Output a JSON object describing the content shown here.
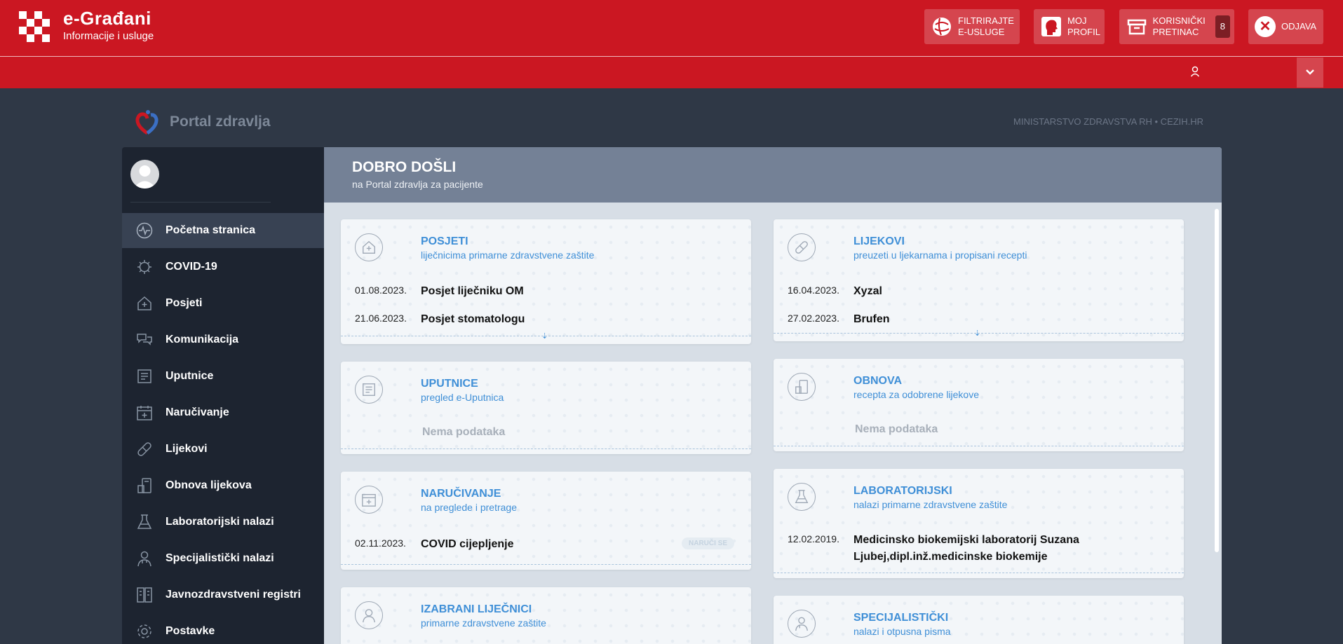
{
  "header": {
    "title": "e-Građani",
    "subtitle": "Informacije i usluge",
    "buttons": {
      "filter": "FILTRIRAJTE E-USLUGE",
      "profile": "MOJ PROFIL",
      "inbox": "KORISNIČKI PRETINAC",
      "inbox_count": "8",
      "logout": "ODJAVA"
    },
    "colors": {
      "brand": "#cb1722"
    }
  },
  "portal": {
    "title": "Portal zdravlja",
    "ministry": "MINISTARSTVO ZDRAVSTVA RH • CEZIH.HR"
  },
  "sidebar": {
    "items": [
      {
        "label": "Početna stranica",
        "icon": "pulse-icon"
      },
      {
        "label": "COVID-19",
        "icon": "virus-icon"
      },
      {
        "label": "Posjeti",
        "icon": "clinic-icon"
      },
      {
        "label": "Komunikacija",
        "icon": "chat-icon"
      },
      {
        "label": "Uputnice",
        "icon": "document-icon"
      },
      {
        "label": "Naručivanje",
        "icon": "calendar-icon"
      },
      {
        "label": "Lijekovi",
        "icon": "pill-icon"
      },
      {
        "label": "Obnova lijekova",
        "icon": "renew-icon"
      },
      {
        "label": "Laboratorijski nalazi",
        "icon": "flask-icon"
      },
      {
        "label": "Specijalistički nalazi",
        "icon": "doctor-icon"
      },
      {
        "label": "Javnozdravstveni registri",
        "icon": "registry-icon"
      },
      {
        "label": "Postavke",
        "icon": "gear-icon"
      }
    ]
  },
  "main": {
    "welcome": "DOBRO DOŠLI",
    "welcome_sub": "na Portal zdravlja za pacijente",
    "cards": {
      "posjeti": {
        "title": "POSJETI",
        "subtitle": "liječnicima primarne zdravstvene zaštite",
        "rows": [
          {
            "date": "01.08.2023.",
            "value": "Posjet liječniku OM"
          },
          {
            "date": "21.06.2023.",
            "value": "Posjet stomatologu"
          }
        ]
      },
      "lijekovi": {
        "title": "LIJEKOVI",
        "subtitle": "preuzeti u ljekarnama i propisani recepti",
        "rows": [
          {
            "date": "16.04.2023.",
            "value": "Xyzal"
          },
          {
            "date": "27.02.2023.",
            "value": "Brufen"
          }
        ]
      },
      "uputnice": {
        "title": "UPUTNICE",
        "subtitle": "pregled e-Uputnica",
        "empty": "Nema podataka"
      },
      "obnova": {
        "title": "OBNOVA",
        "subtitle": "recepta za odobrene lijekove",
        "empty": "Nema podataka"
      },
      "narucivanje": {
        "title": "NARUČIVANJE",
        "subtitle": "na preglede i pretrage",
        "rows": [
          {
            "date": "02.11.2023.",
            "value": "COVID cijepljenje"
          }
        ],
        "action": "NARUČI SE"
      },
      "laboratorijski": {
        "title": "LABORATORIJSKI",
        "subtitle": "nalazi primarne zdravstvene zaštite",
        "rows": [
          {
            "date": "12.02.2019.",
            "value": "Medicinsko biokemijski laboratorij Suzana Ljubej,dipl.inž.medicinske biokemije"
          }
        ]
      },
      "izabrani": {
        "title": "IZABRANI LIJEČNICI",
        "subtitle": "primarne zdravstvene zaštite"
      },
      "specijalisticki": {
        "title": "SPECIJALISTIČKI",
        "subtitle": "nalazi i otpusna pisma"
      }
    }
  }
}
